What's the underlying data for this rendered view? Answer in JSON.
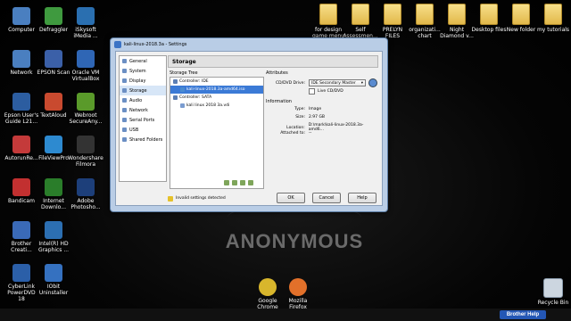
{
  "desktop": {
    "left_icons": [
      {
        "label": "Computer",
        "color": "#4a7fc0"
      },
      {
        "label": "Defraggler",
        "color": "#3f9a3f"
      },
      {
        "label": "iSkysoft iMedia ...",
        "color": "#2a6fb0"
      },
      {
        "label": "Network",
        "color": "#4a7fc0"
      },
      {
        "label": "EPSON Scan",
        "color": "#3b60a8"
      },
      {
        "label": "Oracle VM VirtualBox",
        "color": "#2f66b5"
      },
      {
        "label": "Epson User's Guide L21...",
        "color": "#2c5da0"
      },
      {
        "label": "TextAloud",
        "color": "#c94a2f"
      },
      {
        "label": "Webroot SecureAny...",
        "color": "#5a9a2a"
      },
      {
        "label": "AutorunRe...",
        "color": "#c43a3a"
      },
      {
        "label": "FileViewPro",
        "color": "#2d8ad0"
      },
      {
        "label": "Wondershare Filmora",
        "color": "#333333"
      },
      {
        "label": "Bandicam",
        "color": "#c23030"
      },
      {
        "label": "Internet Downlo...",
        "color": "#2a7d2a"
      },
      {
        "label": "Adobe Photosho...",
        "color": "#1d3f7a"
      },
      {
        "label": "Brother Creati...",
        "color": "#3a6ab8"
      },
      {
        "label": "Intel(R) HD Graphics ...",
        "color": "#2c6fb2"
      },
      {
        "label": "CyberLink PowerDVD 18",
        "color": "#2b5fa8"
      },
      {
        "label": "IObit Uninstaller",
        "color": "#3571c0"
      }
    ],
    "top_right_folders": [
      {
        "label": "for design game menu"
      },
      {
        "label": "Self Assessmen..."
      },
      {
        "label": "PRELYN FILES"
      },
      {
        "label": "organizati... chart"
      },
      {
        "label": "Night Diamond v..."
      },
      {
        "label": "Desktop files"
      },
      {
        "label": "New folder"
      },
      {
        "label": "my tutorials"
      }
    ],
    "bottom_icons": [
      {
        "label": "Google Chrome",
        "color": "#d8b62c"
      },
      {
        "label": "Mozilla Firefox",
        "color": "#e2702a"
      }
    ],
    "recycle_bin": "Recycle Bin",
    "wallpaper_text": "ANONYMOUS"
  },
  "dialog": {
    "title": "kali-linux-2018.3a - Settings",
    "nav": [
      {
        "label": "General",
        "selected": false
      },
      {
        "label": "System",
        "selected": false
      },
      {
        "label": "Display",
        "selected": false
      },
      {
        "label": "Storage",
        "selected": true
      },
      {
        "label": "Audio",
        "selected": false
      },
      {
        "label": "Network",
        "selected": false
      },
      {
        "label": "Serial Ports",
        "selected": false
      },
      {
        "label": "USB",
        "selected": false
      },
      {
        "label": "Shared Folders",
        "selected": false
      }
    ],
    "heading": "Storage",
    "storage_tree_label": "Storage Tree",
    "tree": [
      {
        "label": "Controller: IDE",
        "indent": 0,
        "icon_color": "#5c7fb5",
        "selected": false
      },
      {
        "label": "kali-linux-2018.3a-amd64.iso",
        "indent": 1,
        "icon_color": "#4a8bd0",
        "selected": true
      },
      {
        "label": "Controller: SATA",
        "indent": 0,
        "icon_color": "#5c7fb5",
        "selected": false
      },
      {
        "label": "kali linux 2018 3a.vdi",
        "indent": 1,
        "icon_color": "#7a9cd0",
        "selected": false
      }
    ],
    "attributes_label": "Attributes",
    "cd_drive_label": "CD/DVD Drive:",
    "cd_drive_value": "IDE Secondary Master",
    "live_cd_label": "Live CD/DVD",
    "information_label": "Information",
    "info": [
      {
        "key": "Type:",
        "value": "Image"
      },
      {
        "key": "Size:",
        "value": "2.97 GB"
      },
      {
        "key": "Location:",
        "value": "D:\\mark\\kali-linux-2018.3a-amd6..."
      },
      {
        "key": "Attached to:",
        "value": "--"
      }
    ],
    "invalid_settings": "Invalid settings detected",
    "ok": "OK",
    "cancel": "Cancel",
    "help": "Help"
  },
  "taskbar": {
    "brother_help": "Brother Help"
  }
}
